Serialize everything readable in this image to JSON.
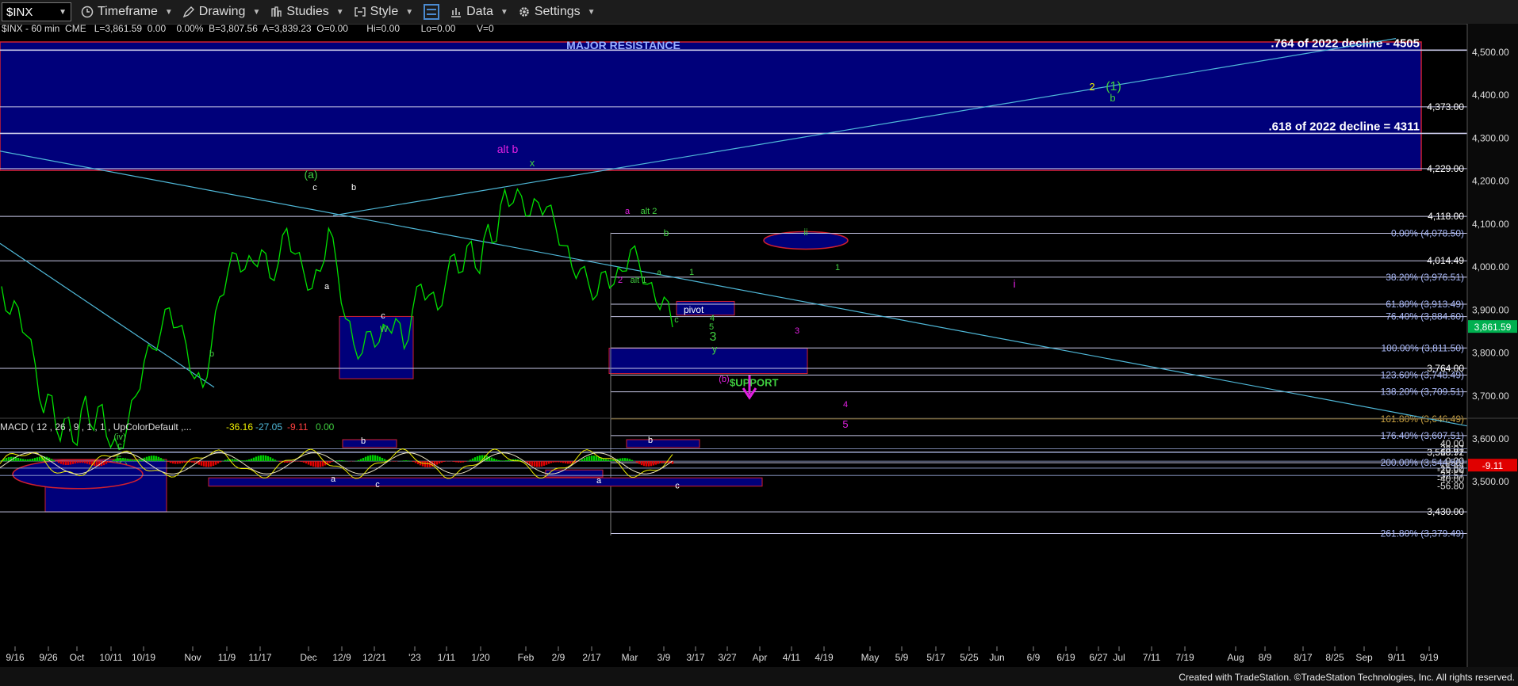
{
  "toolbar": {
    "symbol": "$INX",
    "items": [
      {
        "label": "Timeframe",
        "icon": "clock-icon"
      },
      {
        "label": "Drawing",
        "icon": "pencil-icon"
      },
      {
        "label": "Studies",
        "icon": "studies-icon"
      },
      {
        "label": "Style",
        "icon": "style-icon"
      },
      {
        "label": "",
        "icon": "layout-icon"
      },
      {
        "label": "Data",
        "icon": "bar-chart-icon"
      },
      {
        "label": "Settings",
        "icon": "gear-icon"
      }
    ]
  },
  "header_line": "$INX - 60 min  CME   L=3,861.59  0.00    0.00%  B=3,807.56  A=3,839.23  O=0.00       Hi=0.00        Lo=0.00        V=0",
  "macd_header": {
    "text": "MACD ( 12 , 26 , 9 , 1 , 1 , UpColorDefault ,...",
    "v1": "-36.16",
    "v2": "-27.05",
    "v3": "-9.11",
    "v4": "0.00"
  },
  "footer": "Created with TradeStation. ©TradeStation Technologies, Inc. All rights reserved.",
  "colors": {
    "price": "#00e000",
    "zone_fill": "#00007a",
    "zone_border": "#d02030",
    "trend": "#4fb8d8",
    "magenta": "#e020e0",
    "yellow": "#f0f000",
    "green_label": "#40d040",
    "white_label": "#ffffff",
    "last_price_bg": "#00b050"
  },
  "chart_data": {
    "type": "line",
    "title": "",
    "ylim": [
      3340,
      4560
    ],
    "y_ticks": [
      "4,500.00",
      "4,400.00",
      "4,300.00",
      "4,200.00",
      "4,100.00",
      "4,000.00",
      "3,900.00",
      "3,800.00",
      "3,700.00",
      "3,600.00",
      "3,500.00"
    ],
    "x_ticks": [
      "9/16",
      "9/26",
      "Oct",
      "10/11",
      "10/19",
      "Nov",
      "11/9",
      "11/17",
      "Dec",
      "12/9",
      "12/21",
      "'23",
      "1/11",
      "1/20",
      "Feb",
      "2/9",
      "2/17",
      "Mar",
      "3/9",
      "3/17",
      "3/27",
      "Apr",
      "4/11",
      "4/19",
      "May",
      "5/9",
      "5/17",
      "5/25",
      "Jun",
      "6/9",
      "6/19",
      "6/27",
      "Jul",
      "7/11",
      "7/19",
      "Aug",
      "8/9",
      "8/17",
      "8/25",
      "Sep",
      "9/11",
      "9/19"
    ],
    "last_price": "3,861.59",
    "series": [
      {
        "values": [
          3955,
          3890,
          3905,
          3840,
          3775,
          3660,
          3700,
          3595,
          3650,
          3585,
          3700,
          3620,
          3680,
          3580,
          3575,
          3630,
          3700,
          3780,
          3810,
          3850,
          3905,
          3860,
          3820,
          3740,
          3720,
          3815,
          3930,
          3990,
          4030,
          3995,
          4010,
          4040,
          3975,
          4010,
          4090,
          4030,
          3990,
          3950,
          3990,
          4090,
          4000,
          3880,
          3820,
          3800,
          3850,
          3825,
          3860,
          3880,
          3810,
          3900,
          3960,
          3935,
          3900,
          3970,
          4030,
          3990,
          4060,
          3985,
          4100,
          4060,
          4180,
          4150,
          4165,
          4120,
          4150,
          4140,
          4100,
          4050,
          4000,
          3995,
          3960,
          3935,
          3990,
          3960,
          3990,
          4040,
          4010,
          3960,
          3920,
          3930,
          3860
        ]
      }
    ],
    "levels": [
      {
        "value": 4505,
        "text": ".764 of 2022 decline - 4505"
      },
      {
        "value": 4373,
        "text": "4,373.00"
      },
      {
        "value": 4311,
        "text": ".618 of 2022 decline = 4311"
      },
      {
        "value": 4229,
        "text": "4,229.00"
      },
      {
        "value": 4118,
        "text": "4,118.00"
      },
      {
        "value": 4078.5,
        "text": "0.00% (4,078.50)"
      },
      {
        "value": 4014.49,
        "text": "4,014.49"
      },
      {
        "value": 3976.51,
        "text": "38.20% (3,976.51)"
      },
      {
        "value": 3913.49,
        "text": "61.80% (3,913.49)"
      },
      {
        "value": 3884.6,
        "text": "76.40% (3,884.60)"
      },
      {
        "value": 3811.5,
        "text": "100.00% (3,811.50)"
      },
      {
        "value": 3764,
        "text": "3,764.00"
      },
      {
        "value": 3748.49,
        "text": "123.60% (3,748.49)"
      },
      {
        "value": 3709.51,
        "text": "138.20% (3,709.51)"
      },
      {
        "value": 3646.49,
        "text": "161.80% (3,646.49)"
      },
      {
        "value": 3607.51,
        "text": "176.40% (3,607.51)"
      },
      {
        "value": 3568.97,
        "text": "3,568.97"
      },
      {
        "value": 3544.5,
        "text": "200.00% (3,544.50)"
      },
      {
        "value": 3430,
        "text": "3,430.00"
      },
      {
        "value": 3379.49,
        "text": "261.80% (3,379.49)"
      }
    ],
    "zone_labels": {
      "resistance": "MAJOR RESISTANCE",
      "support": "$UPPORT",
      "pivot": "pivot"
    },
    "annotations": [
      "alt b",
      "x",
      "(a)",
      "c",
      "b",
      "a",
      "w",
      "c",
      "b",
      "a",
      "(iv)",
      "c",
      "5",
      "(c)",
      "a",
      "alt 2",
      "b",
      "2",
      "alt 1",
      "a",
      "1",
      "4",
      "5",
      "c",
      "3",
      "y",
      "(b)",
      "3",
      "4",
      "5",
      "i",
      "ii",
      "1",
      "2",
      "(1)",
      "b",
      "(c)"
    ],
    "macd": {
      "y_ticks": [
        "40.00",
        "28.07",
        "19.72",
        "0.00",
        "-15.82",
        "-20.00",
        "-32.57",
        "-40.00",
        "-56.80"
      ],
      "current": "-9.11",
      "labels": [
        "b",
        "b",
        "a",
        "c",
        "a",
        "c"
      ]
    }
  }
}
